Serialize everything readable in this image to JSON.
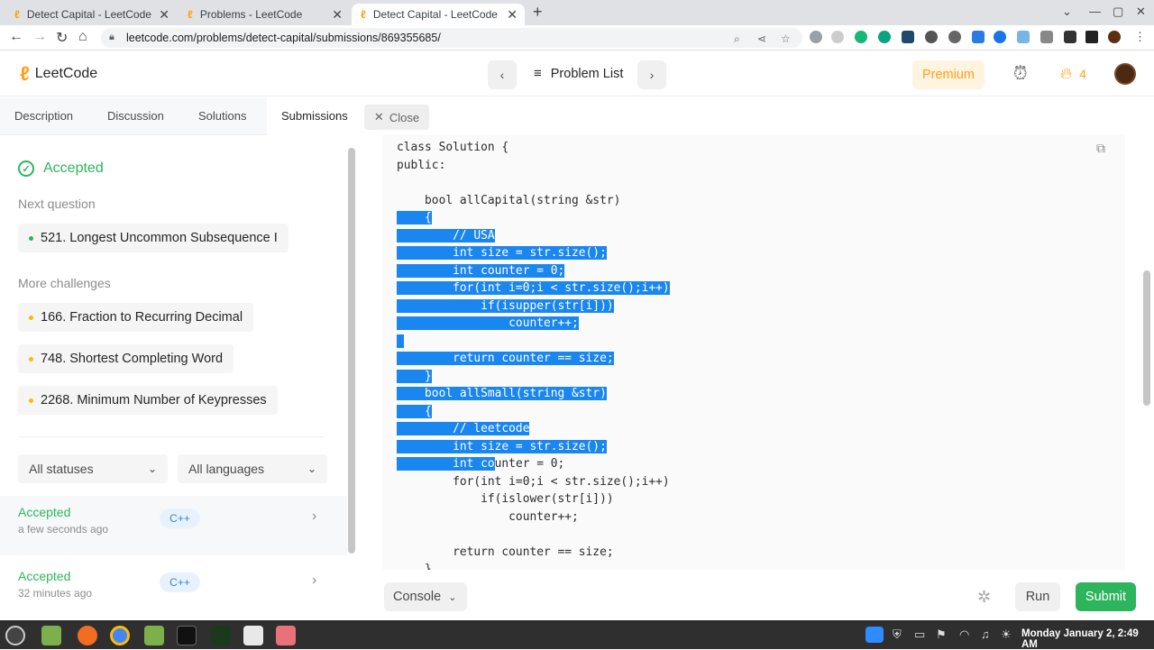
{
  "browser": {
    "tabs": [
      {
        "title": "Detect Capital - LeetCode"
      },
      {
        "title": "Problems - LeetCode"
      },
      {
        "title": "Detect Capital - LeetCode"
      }
    ],
    "url": "leetcode.com/problems/detect-capital/submissions/869355685/"
  },
  "header": {
    "logo": "LeetCode",
    "problem_list": "Problem List",
    "premium": "Premium",
    "streak": "4"
  },
  "left_tabs": [
    "Description",
    "Discussion",
    "Solutions",
    "Submissions"
  ],
  "close_label": "Close",
  "result": {
    "status": "Accepted",
    "next_question_label": "Next question",
    "next_question": "521. Longest Uncommon Subsequence I",
    "more_challenges_label": "More challenges",
    "challenges": [
      {
        "title": "166. Fraction to Recurring Decimal",
        "color": "#ffb800"
      },
      {
        "title": "748. Shortest Completing Word",
        "color": "#ffb800"
      },
      {
        "title": "2268. Minimum Number of Keypresses",
        "color": "#ffb800"
      }
    ]
  },
  "filters": {
    "status": "All statuses",
    "language": "All languages"
  },
  "submissions": [
    {
      "status": "Accepted",
      "time": "a few seconds ago",
      "lang": "C++"
    },
    {
      "status": "Accepted",
      "time": "32 minutes ago",
      "lang": "C++"
    }
  ],
  "code_lines": [
    "class Solution {",
    "public:",
    "",
    "    bool allCapital(string &str)",
    "    {",
    "        // USA",
    "        int size = str.size();",
    "        int counter = 0;",
    "        for(int i=0;i < str.size();i++)",
    "            if(isupper(str[i]))",
    "                counter++;",
    "",
    "        return counter == size;",
    "    }",
    "    bool allSmall(string &str)",
    "    {",
    "        // leetcode",
    "        int size = str.size();",
    "        int counter = 0;",
    "        for(int i=0;i < str.size();i++)",
    "            if(islower(str[i]))",
    "                counter++;",
    "",
    "        return counter == size;",
    "    }"
  ],
  "bottom": {
    "console": "Console",
    "run": "Run",
    "submit": "Submit"
  },
  "taskbar": {
    "clock": "Monday January 2, 2:49 AM"
  }
}
